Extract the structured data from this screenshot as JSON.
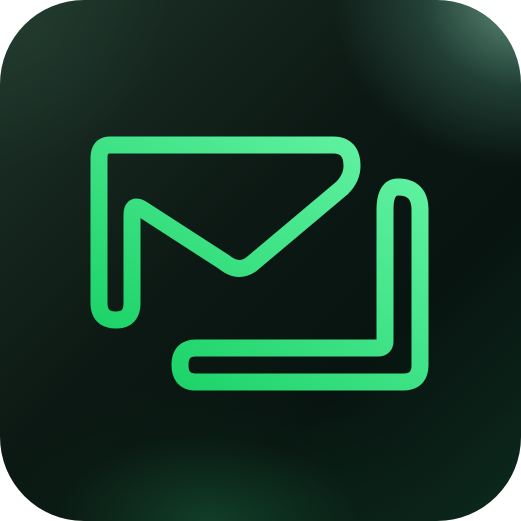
{
  "icon": {
    "name": "mail-forward-app-icon",
    "stroke_color_start": "#1ed46a",
    "stroke_color_end": "#5ef0a0",
    "background_accent": "#5a8f78"
  }
}
